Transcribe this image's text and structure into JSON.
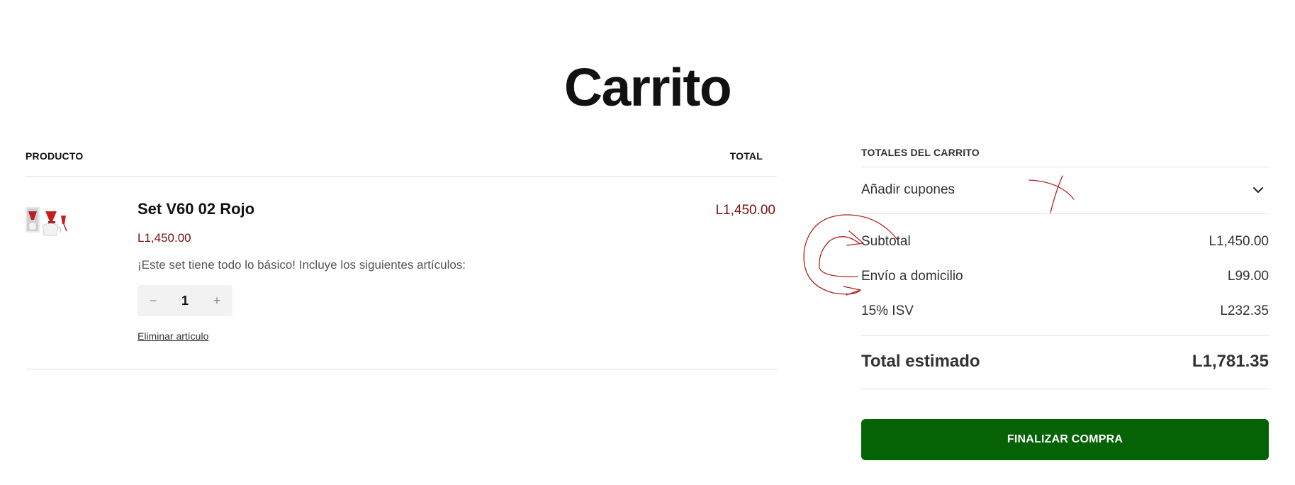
{
  "page": {
    "title": "Carrito"
  },
  "cart": {
    "headers": {
      "product": "PRODUCTO",
      "total": "TOTAL"
    },
    "item": {
      "name": "Set V60 02 Rojo",
      "price": "L1,450.00",
      "description": "¡Este set tiene todo lo básico! Incluye los siguientes artículos:",
      "quantity": "1",
      "decrement": "−",
      "increment": "+",
      "remove_label": "Eliminar artículo",
      "line_total": "L1,450.00"
    }
  },
  "totals": {
    "heading": "TOTALES DEL CARRITO",
    "coupon_label": "Añadir cupones",
    "rows": [
      {
        "label": "Subtotal",
        "value": "L1,450.00"
      },
      {
        "label": "Envío a domicilio",
        "value": "L99.00"
      },
      {
        "label": "15% ISV",
        "value": "L232.35"
      }
    ],
    "estimated_label": "Total estimado",
    "estimated_value": "L1,781.35",
    "checkout_label": "FINALIZAR COMPRA"
  },
  "colors": {
    "price": "#7a1111",
    "checkout_bg": "#056205",
    "annotation": "#b22222"
  },
  "icons": {
    "coupon_toggle": "chevron-down-icon",
    "product_image": "product-thumbnail"
  }
}
